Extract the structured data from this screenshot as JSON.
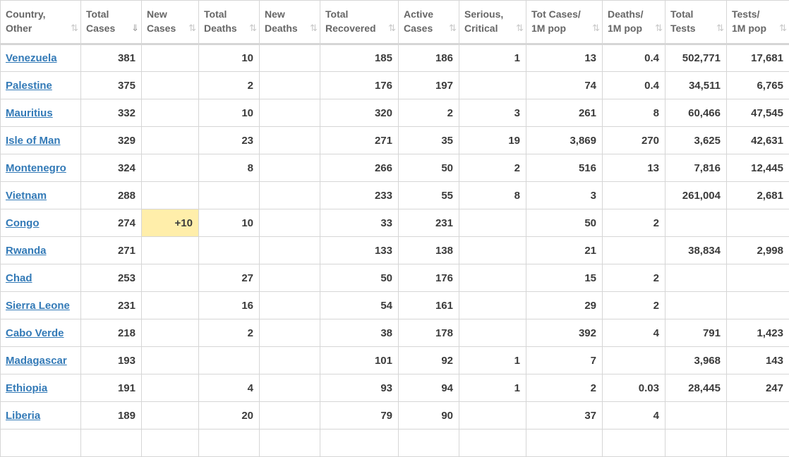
{
  "headers": [
    {
      "l1": "Country,",
      "l2": "Other",
      "sort": "⇅",
      "active": false
    },
    {
      "l1": "Total",
      "l2": "Cases",
      "sort": "⇓",
      "active": true
    },
    {
      "l1": "New",
      "l2": "Cases",
      "sort": "⇅",
      "active": false
    },
    {
      "l1": "Total",
      "l2": "Deaths",
      "sort": "⇅",
      "active": false
    },
    {
      "l1": "New",
      "l2": "Deaths",
      "sort": "⇅",
      "active": false
    },
    {
      "l1": "Total",
      "l2": "Recovered",
      "sort": "⇅",
      "active": false
    },
    {
      "l1": "Active",
      "l2": "Cases",
      "sort": "⇅",
      "active": false
    },
    {
      "l1": "Serious,",
      "l2": "Critical",
      "sort": "⇅",
      "active": false
    },
    {
      "l1": "Tot Cases/",
      "l2": "1M pop",
      "sort": "⇅",
      "active": false
    },
    {
      "l1": "Deaths/",
      "l2": "1M pop",
      "sort": "⇅",
      "active": false
    },
    {
      "l1": "Total",
      "l2": "Tests",
      "sort": "⇅",
      "active": false
    },
    {
      "l1": "Tests/",
      "l2": "1M pop",
      "sort": "⇅",
      "active": false
    }
  ],
  "rows": [
    [
      "Venezuela",
      "381",
      "",
      "10",
      "",
      "185",
      "186",
      "1",
      "13",
      "0.4",
      "502,771",
      "17,681"
    ],
    [
      "Palestine",
      "375",
      "",
      "2",
      "",
      "176",
      "197",
      "",
      "74",
      "0.4",
      "34,511",
      "6,765"
    ],
    [
      "Mauritius",
      "332",
      "",
      "10",
      "",
      "320",
      "2",
      "3",
      "261",
      "8",
      "60,466",
      "47,545"
    ],
    [
      "Isle of Man",
      "329",
      "",
      "23",
      "",
      "271",
      "35",
      "19",
      "3,869",
      "270",
      "3,625",
      "42,631"
    ],
    [
      "Montenegro",
      "324",
      "",
      "8",
      "",
      "266",
      "50",
      "2",
      "516",
      "13",
      "7,816",
      "12,445"
    ],
    [
      "Vietnam",
      "288",
      "",
      "",
      "",
      "233",
      "55",
      "8",
      "3",
      "",
      "261,004",
      "2,681"
    ],
    [
      "Congo",
      "274",
      "+10",
      "10",
      "",
      "33",
      "231",
      "",
      "50",
      "2",
      "",
      ""
    ],
    [
      "Rwanda",
      "271",
      "",
      "",
      "",
      "133",
      "138",
      "",
      "21",
      "",
      "38,834",
      "2,998"
    ],
    [
      "Chad",
      "253",
      "",
      "27",
      "",
      "50",
      "176",
      "",
      "15",
      "2",
      "",
      ""
    ],
    [
      "Sierra Leone",
      "231",
      "",
      "16",
      "",
      "54",
      "161",
      "",
      "29",
      "2",
      "",
      ""
    ],
    [
      "Cabo Verde",
      "218",
      "",
      "2",
      "",
      "38",
      "178",
      "",
      "392",
      "4",
      "791",
      "1,423"
    ],
    [
      "Madagascar",
      "193",
      "",
      "",
      "",
      "101",
      "92",
      "1",
      "7",
      "",
      "3,968",
      "143"
    ],
    [
      "Ethiopia",
      "191",
      "",
      "4",
      "",
      "93",
      "94",
      "1",
      "2",
      "0.03",
      "28,445",
      "247"
    ],
    [
      "Liberia",
      "189",
      "",
      "20",
      "",
      "79",
      "90",
      "",
      "37",
      "4",
      "",
      ""
    ],
    [
      "",
      "",
      "",
      "",
      "",
      "",
      "",
      "",
      "",
      "",
      "",
      ""
    ]
  ],
  "colors": {
    "link": "#337ab7",
    "new_cases_highlight": "#ffeeaa",
    "border": "#d6d6d6",
    "header_text": "#666666"
  }
}
